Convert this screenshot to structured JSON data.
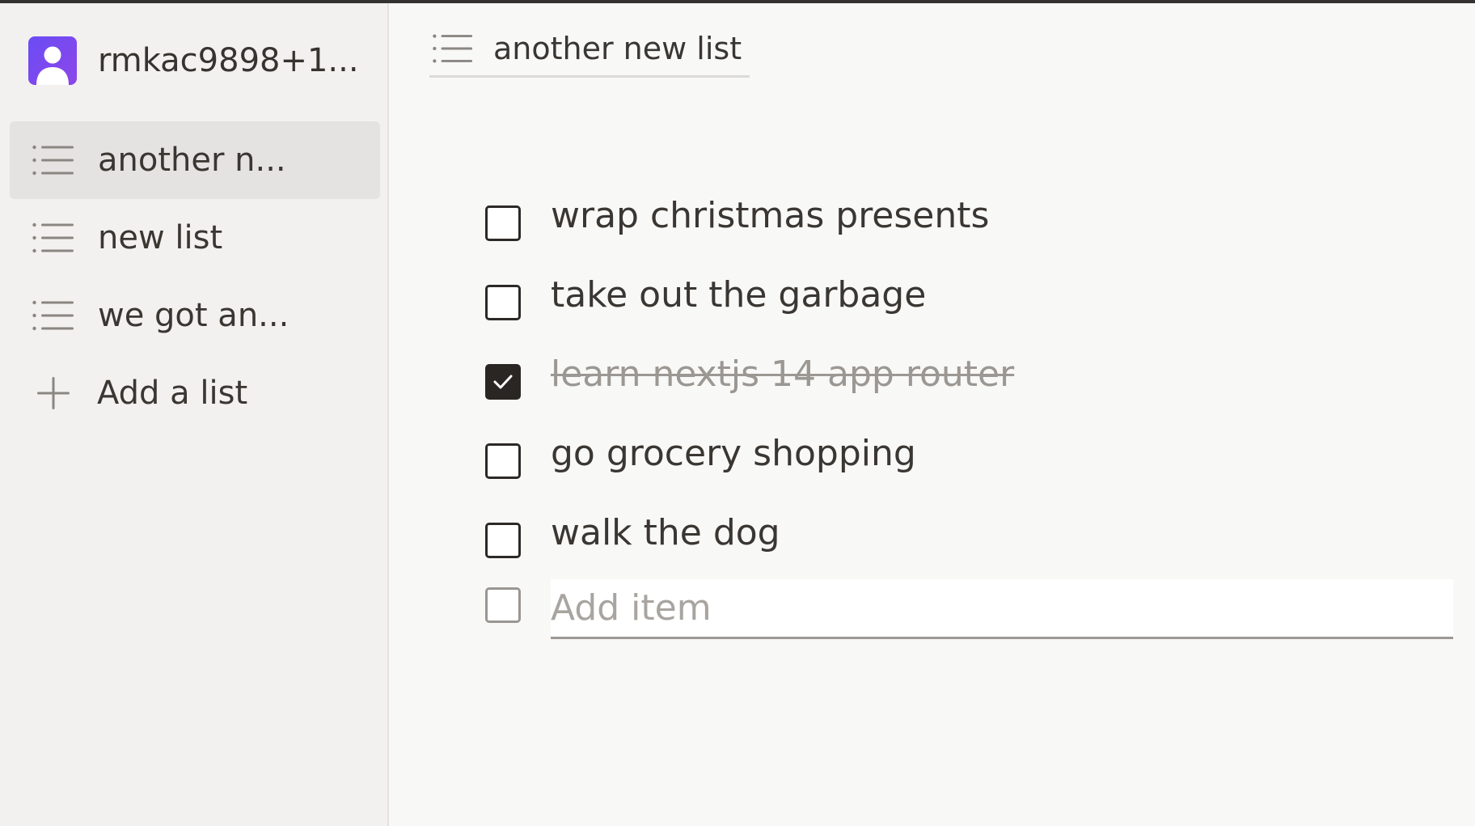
{
  "account": {
    "name": "rmkac9898+1..."
  },
  "sidebar": {
    "items": [
      {
        "label": "another n...",
        "active": true,
        "icon": "list-icon"
      },
      {
        "label": "new list",
        "active": false,
        "icon": "list-icon"
      },
      {
        "label": "we got an...",
        "active": false,
        "icon": "list-icon"
      }
    ],
    "add_list_label": "Add a list",
    "add_list_icon": "plus-icon"
  },
  "main": {
    "title": "another new list",
    "title_icon": "list-icon",
    "todos": [
      {
        "text": "wrap christmas presents",
        "done": false
      },
      {
        "text": "take out the garbage",
        "done": false
      },
      {
        "text": "learn nextjs 14 app router",
        "done": true
      },
      {
        "text": "go grocery shopping",
        "done": false
      },
      {
        "text": "walk the dog",
        "done": false
      }
    ],
    "add_item_placeholder": "Add item"
  },
  "colors": {
    "background": "#f8f8f7",
    "sidebar": "#f2f1ef",
    "active_item": "#e5e3e1",
    "avatar_gradient_start": "#6a4cf5",
    "avatar_gradient_end": "#8d46e8",
    "checked": "#2a2623"
  }
}
